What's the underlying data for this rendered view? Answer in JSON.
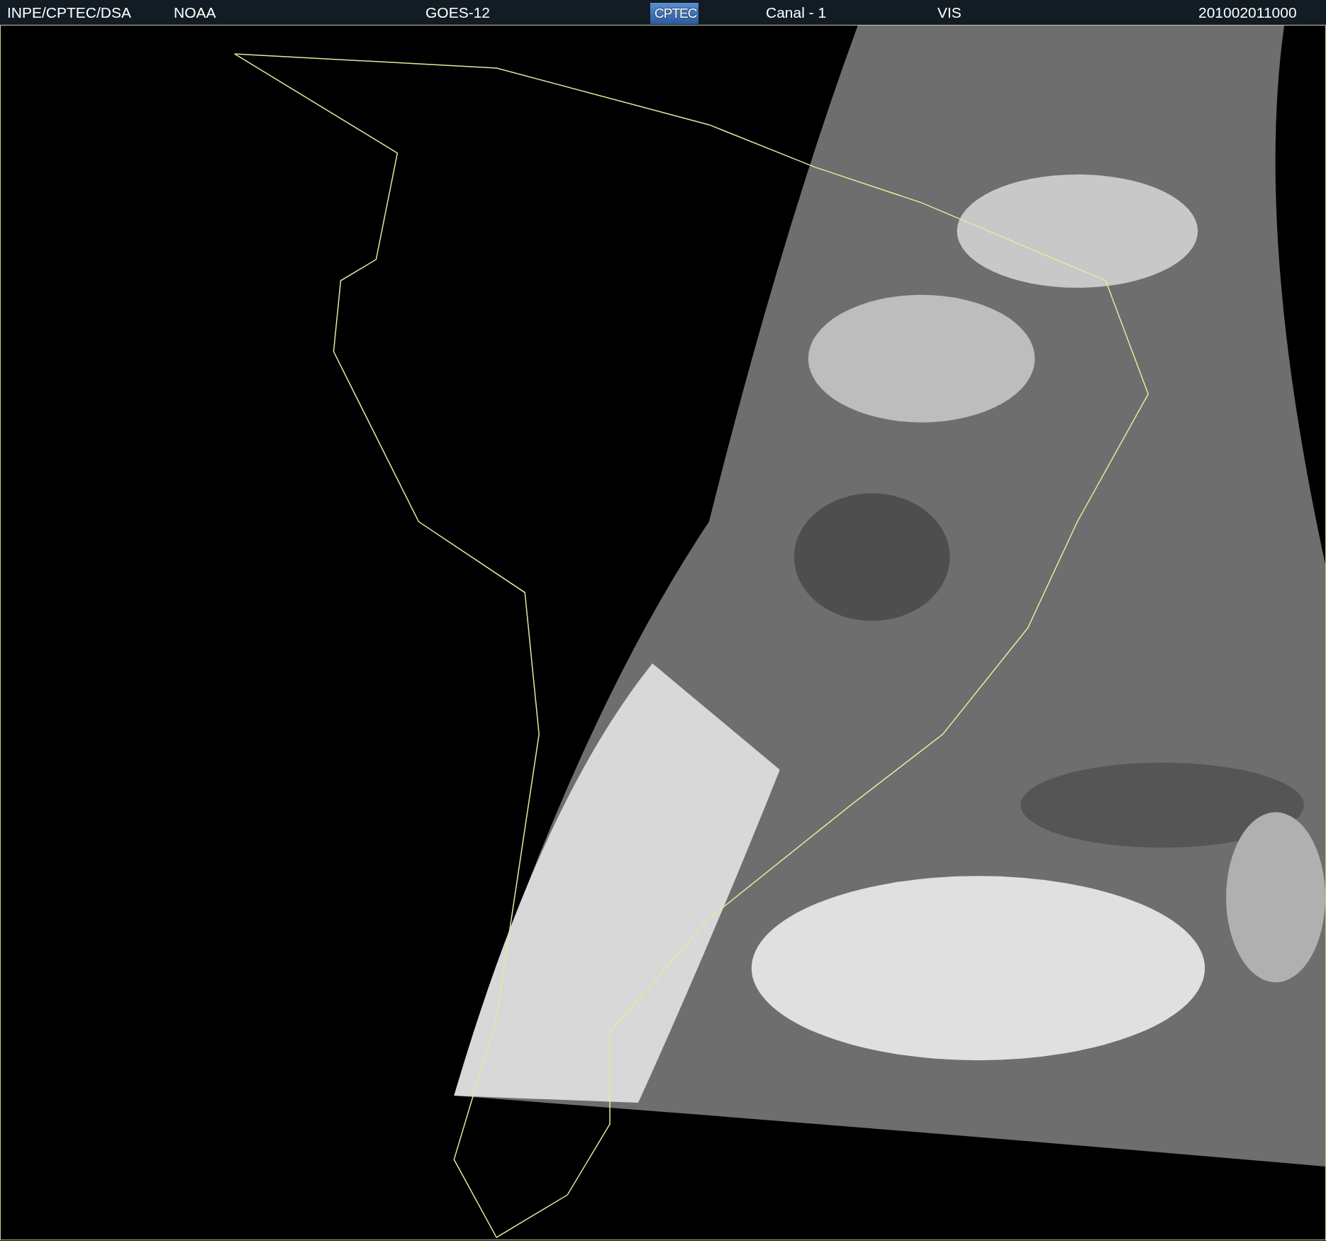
{
  "header": {
    "items": [
      {
        "kind": "text",
        "text": "INPE/CPTEC/DSA"
      },
      {
        "kind": "text",
        "text": "NOAA"
      },
      {
        "kind": "text",
        "text": "GOES-12"
      },
      {
        "kind": "logo",
        "text": "CPTEC"
      },
      {
        "kind": "text",
        "text": "Canal - 1"
      },
      {
        "kind": "text",
        "text": "VIS"
      },
      {
        "kind": "text",
        "text": "201002011000"
      }
    ]
  }
}
